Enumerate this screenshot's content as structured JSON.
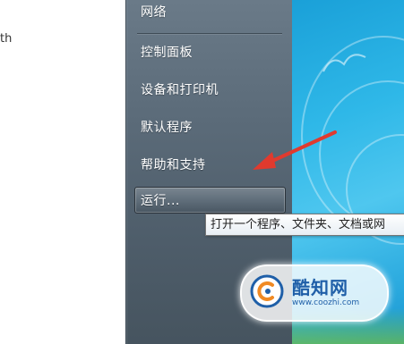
{
  "left_clip_text": "th",
  "start_menu": {
    "items": [
      {
        "label": "网络"
      },
      {
        "label": "控制面板"
      },
      {
        "label": "设备和打印机"
      },
      {
        "label": "默认程序"
      },
      {
        "label": "帮助和支持"
      },
      {
        "label": "运行..."
      }
    ]
  },
  "tooltip": {
    "text": "打开一个程序、文件夹、文档或网"
  },
  "watermark": {
    "brand": "酷知网",
    "url": "www.coozhi.com"
  },
  "colors": {
    "menu_bg": "#5b6b79",
    "desktop": "#2fb8e8",
    "arrow": "#e03a2e",
    "brand": "#1f5fa8"
  },
  "icons": [
    "red-arrow-annotation",
    "watermark-logo-icon"
  ]
}
